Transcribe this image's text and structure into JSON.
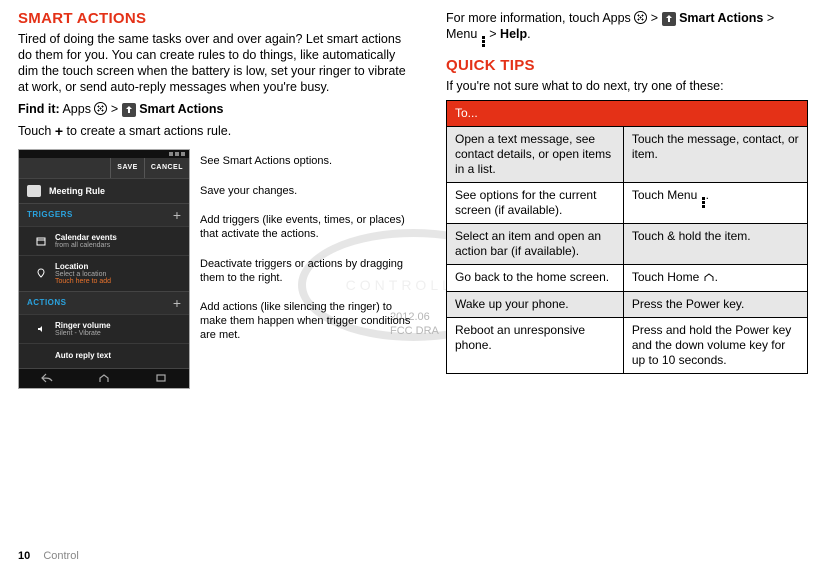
{
  "left": {
    "heading": "Smart actions",
    "intro": "Tired of doing the same tasks over and over again? Let smart actions do them for you. You can create rules to do things, like automatically dim the touch screen when the battery is low, set your ringer to vibrate at work, or send auto-reply messages when you're busy.",
    "findit_label": "Find it:",
    "findit_apps": "Apps",
    "findit_gt1": ">",
    "findit_app": "Smart Actions",
    "touch_prefix": "Touch",
    "touch_plus": "+",
    "touch_suffix": "to create a smart actions rule.",
    "phone": {
      "save": "SAVE",
      "cancel": "CANCEL",
      "rule_name": "Meeting Rule",
      "triggers_label": "TRIGGERS",
      "triggers": [
        {
          "main": "Calendar events",
          "sub": "from all calendars"
        },
        {
          "main": "Location",
          "sub": "Select a location",
          "sub2": "Touch here to add"
        }
      ],
      "actions_label": "ACTIONS",
      "actions": [
        {
          "main": "Ringer volume",
          "sub": "Silent - Vibrate"
        },
        {
          "main": "Auto reply text",
          "sub": ""
        }
      ]
    },
    "callouts": {
      "c1": "See Smart Actions options.",
      "c2": "Save your changes.",
      "c3": "Add triggers (like events, times, or places) that activate the actions.",
      "c4": "Deactivate triggers or actions by dragging them to the right.",
      "c5": "Add actions (like silencing the ringer) to make them happen when trigger conditions are met."
    }
  },
  "right": {
    "more_info_prefix": "For more information, touch Apps",
    "more_info_app": "Smart Actions",
    "more_info_menu": "> Menu",
    "more_info_help": "Help",
    "gt": ">",
    "period": ".",
    "heading": "Quick tips",
    "intro": "If you're not sure what to do next, try one of these:",
    "table": {
      "header": "To...",
      "rows": [
        {
          "a": "Open a text message, see contact details, or open items in a list.",
          "b": "Touch the message, contact, or item."
        },
        {
          "a": "See options for the current screen (if available).",
          "b_pre": "Touch Menu ",
          "b_post": "."
        },
        {
          "a": "Select an item and open an action bar (if available).",
          "b": "Touch & hold the item."
        },
        {
          "a": "Go back to the home screen.",
          "b_pre": "Touch Home ",
          "b_post": "."
        },
        {
          "a": "Wake up your phone.",
          "b": "Press the Power key."
        },
        {
          "a": "Reboot an unresponsive phone.",
          "b": "Press and hold the Power key and the down volume key for up to 10 seconds."
        }
      ]
    }
  },
  "draft": {
    "l1": "2012.06",
    "l2": "FCC DRA"
  },
  "footer": {
    "page": "10",
    "section": "Control"
  }
}
